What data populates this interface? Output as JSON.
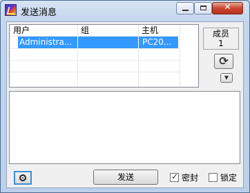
{
  "window": {
    "title": "发送消息",
    "controls": {
      "minimize": "minimize",
      "maximize": "maximize",
      "close": "✕"
    }
  },
  "user_list": {
    "columns": [
      "用户",
      "组",
      "主机"
    ],
    "rows": [
      {
        "user": "Administra...",
        "group": "",
        "host": "PC20...",
        "selected": true
      }
    ]
  },
  "members": {
    "label": "成员",
    "count": "1"
  },
  "refresh_icon": "⟳",
  "dropdown_icon": "▼",
  "message": {
    "value": ""
  },
  "footer": {
    "send_label": "发送",
    "encrypt_label": "密封",
    "encrypt_checked": true,
    "lock_label": "锁定",
    "lock_checked": false
  },
  "colors": {
    "selection": "#3399ff",
    "title_bg": "#c9d8ec",
    "close_button": "#c9452f"
  }
}
